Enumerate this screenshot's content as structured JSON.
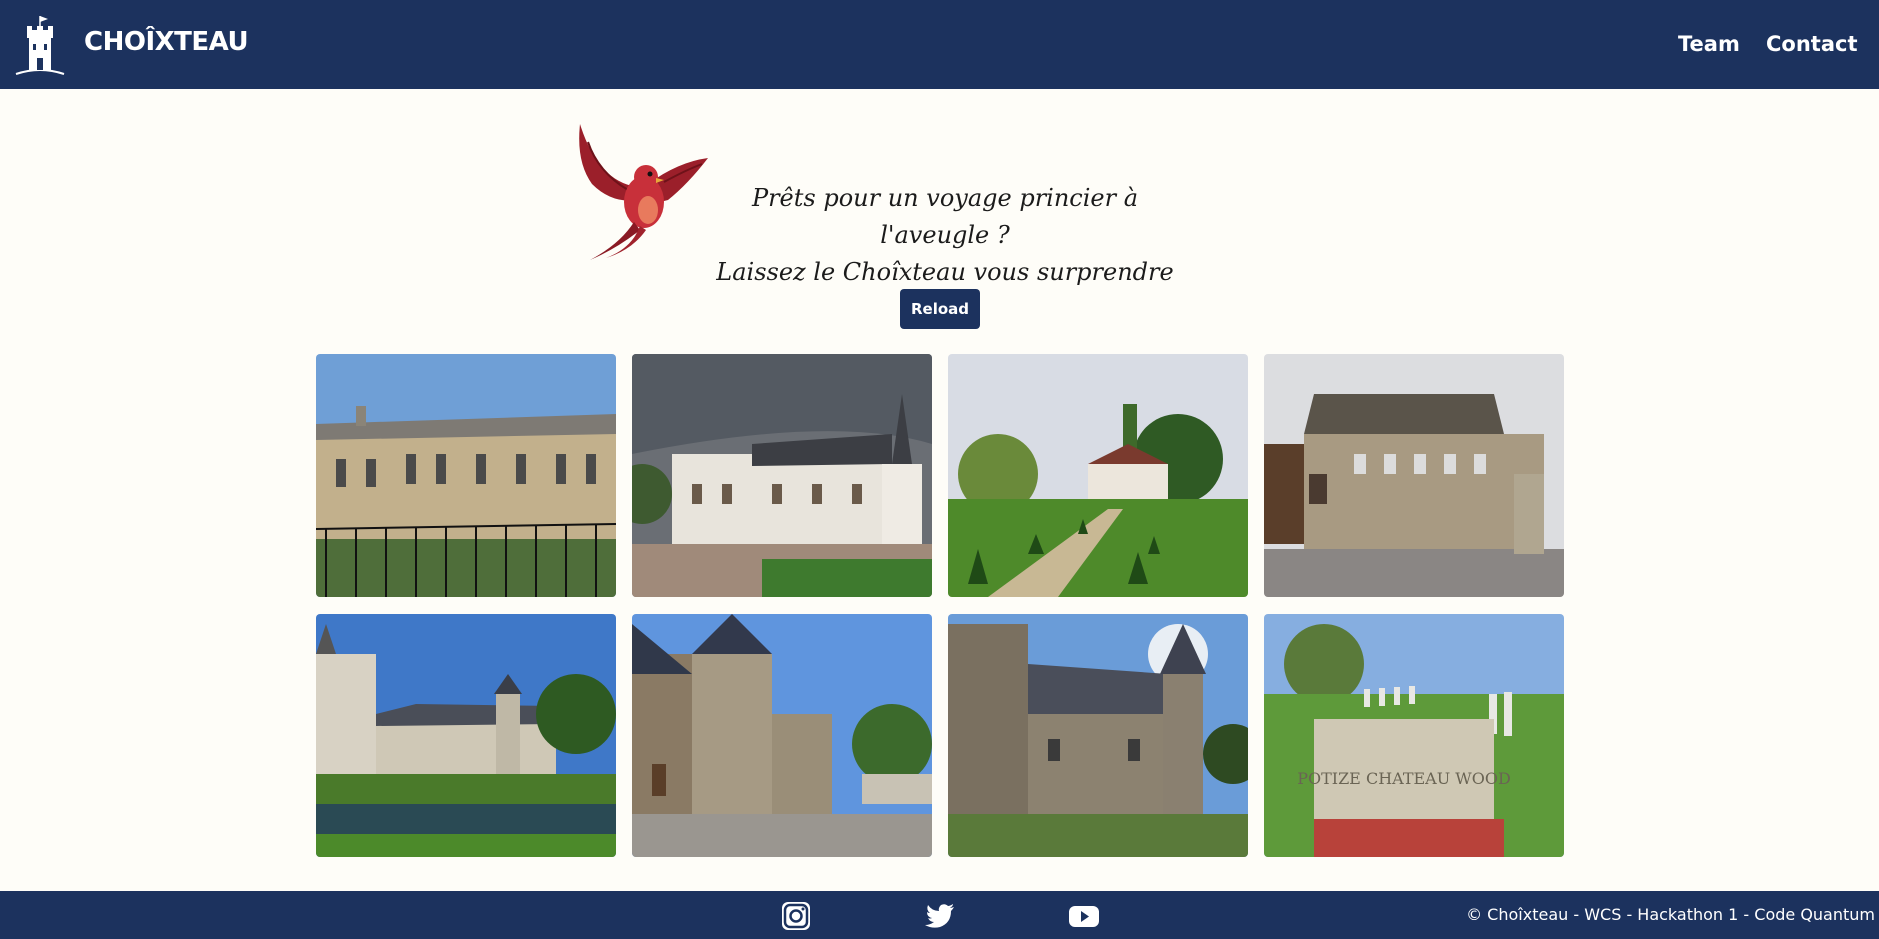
{
  "header": {
    "brand": "CHOÎXTEAU",
    "nav": [
      {
        "label": "Team"
      },
      {
        "label": "Contact"
      }
    ]
  },
  "hero": {
    "tagline_line1": "Prêts pour un voyage princier à l'aveugle ?",
    "tagline_line2": "Laissez le Choîxteau vous surprendre !",
    "reload_label": "Reload"
  },
  "gallery": {
    "items": [
      {
        "image": "classical-stone-palace"
      },
      {
        "image": "white-chateau-with-turret"
      },
      {
        "image": "manor-with-garden-path"
      },
      {
        "image": "old-stone-house"
      },
      {
        "image": "castle-with-moat"
      },
      {
        "image": "stone-tower-courtyard"
      },
      {
        "image": "granite-manor-towers"
      },
      {
        "image": "memorial-stone-cemetery"
      }
    ],
    "lettering": "POTIZE CHATEAU WOOD"
  },
  "footer": {
    "socials": [
      "instagram-icon",
      "twitter-icon",
      "youtube-icon"
    ],
    "copyright": "© Choîxteau - WCS - Hackathon 1 - Code Quantum"
  },
  "colors": {
    "primary": "#1c325e",
    "background": "#fefdf8"
  }
}
